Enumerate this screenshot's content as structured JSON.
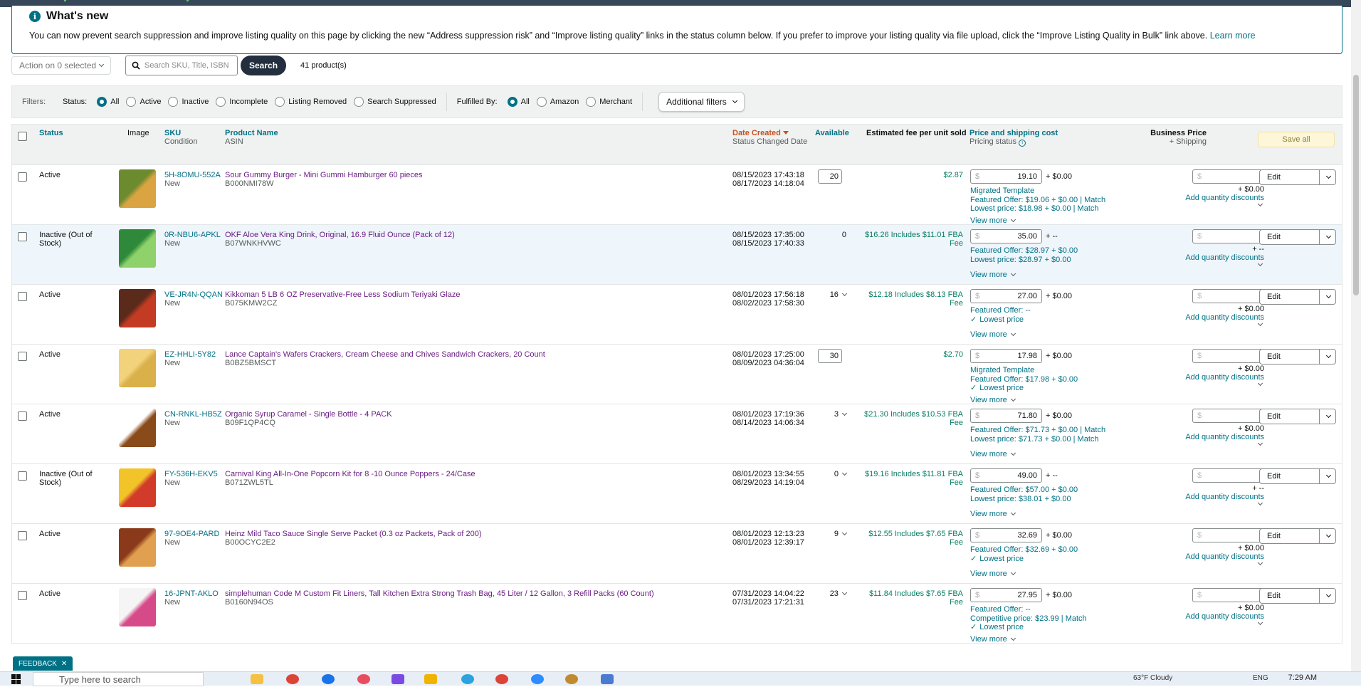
{
  "banner": {
    "title": "What's new",
    "message": "You can now prevent search suppression and improve listing quality on this page by clicking the new “Address suppression risk” and “Improve listing quality” links in the status column below. If you prefer to improve your listing quality via file upload, click the “Improve Listing Quality in Bulk” link above.",
    "learn_more": "Learn more"
  },
  "toolbar": {
    "action_label": "Action on 0 selected",
    "search_placeholder": "Search SKU, Title, ISBN",
    "search_button": "Search",
    "product_count": "41 product(s)"
  },
  "filters": {
    "label": "Filters:",
    "status_label": "Status:",
    "status_options": [
      "All",
      "Active",
      "Inactive",
      "Incomplete",
      "Listing Removed",
      "Search Suppressed"
    ],
    "fulfilled_label": "Fulfilled By:",
    "fulfilled_options": [
      "All",
      "Amazon",
      "Merchant"
    ],
    "additional_filters": "Additional filters"
  },
  "columns": {
    "status": "Status",
    "image": "Image",
    "sku": "SKU",
    "condition": "Condition",
    "product_name": "Product Name",
    "asin": "ASIN",
    "date_created": "Date Created",
    "status_changed": "Status Changed Date",
    "available": "Available",
    "est_fee": "Estimated fee per unit sold",
    "price_shipping": "Price and shipping cost",
    "pricing_status": "Pricing status",
    "business_price": "Business Price",
    "plus_shipping": "+ Shipping",
    "save_all": "Save all"
  },
  "common": {
    "dollar": "$",
    "add_qty": "Add quantity discounts",
    "view_more": "View more",
    "edit": "Edit",
    "bp_ship": "+ $0.00",
    "bp_ship_dash": "+ --"
  },
  "rows": [
    {
      "status": "Active",
      "sku": "5H-8OMU-552A",
      "condition": "New",
      "name": "Sour Gummy Burger - Mini Gummi Hamburger 60 pieces",
      "asin": "B000NMI78W",
      "created": "08/15/2023 17:43:18",
      "changed": "08/17/2023 14:18:04",
      "available": "20",
      "fee": "$2.87",
      "price": "19.10",
      "ship": "+ $0.00",
      "lines": [
        "Migrated Template",
        "Featured Offer: $19.06 + $0.00 | Match",
        "Lowest price: $18.98 + $0.00 | Match"
      ],
      "bp_ship": "+ $0.00"
    },
    {
      "status": "Inactive (Out of Stock)",
      "sku": "0R-NBU6-APKL",
      "condition": "New",
      "name": "OKF Aloe Vera King Drink, Original, 16.9 Fluid Ounce (Pack of 12)",
      "asin": "B07WNKHVWC",
      "created": "08/15/2023 17:35:00",
      "changed": "08/15/2023 17:40:33",
      "available": "0",
      "fee": "$16.26 Includes $11.01 FBA Fee",
      "price": "35.00",
      "ship": "+ --",
      "lines": [
        "Featured Offer: $28.97 + $0.00",
        "Lowest price: $28.97 + $0.00"
      ],
      "bp_ship": "+ --"
    },
    {
      "status": "Active",
      "sku": "VE-JR4N-QQAN",
      "condition": "New",
      "name": "Kikkoman 5 LB 6 OZ Preservative-Free Less Sodium Teriyaki Glaze",
      "asin": "B075KMW2CZ",
      "created": "08/01/2023 17:56:18",
      "changed": "08/02/2023 17:58:30",
      "available": "16",
      "fee": "$12.18 Includes $8.13 FBA Fee",
      "price": "27.00",
      "ship": "+ $0.00",
      "lines": [
        "Featured Offer: --",
        "✓ Lowest price"
      ],
      "bp_ship": "+ $0.00"
    },
    {
      "status": "Active",
      "sku": "EZ-HHLI-5Y82",
      "condition": "New",
      "name": "Lance Captain's Wafers Crackers, Cream Cheese and Chives Sandwich Crackers, 20 Count",
      "asin": "B0BZ5BMSCT",
      "created": "08/01/2023 17:25:00",
      "changed": "08/09/2023 04:36:04",
      "available": "30",
      "fee": "$2.70",
      "price": "17.98",
      "ship": "+ $0.00",
      "lines": [
        "Migrated Template",
        "Featured Offer: $17.98 + $0.00",
        "✓ Lowest price"
      ],
      "bp_ship": "+ $0.00"
    },
    {
      "status": "Active",
      "sku": "CN-RNKL-HB5Z",
      "condition": "New",
      "name": "Organic Syrup Caramel - Single Bottle - 4 PACK",
      "asin": "B09F1QP4CQ",
      "created": "08/01/2023 17:19:36",
      "changed": "08/14/2023 14:06:34",
      "available": "3",
      "fee": "$21.30 Includes $10.53 FBA Fee",
      "price": "71.80",
      "ship": "+ $0.00",
      "lines": [
        "Featured Offer: $71.73 + $0.00 | Match",
        "Lowest price: $71.73 + $0.00 | Match"
      ],
      "bp_ship": "+ $0.00"
    },
    {
      "status": "Inactive (Out of Stock)",
      "sku": "FY-536H-EKV5",
      "condition": "New",
      "name": "Carnival King All-In-One Popcorn Kit for 8 -10 Ounce Poppers - 24/Case",
      "asin": "B071ZWL5TL",
      "created": "08/01/2023 13:34:55",
      "changed": "08/29/2023 14:19:04",
      "available": "0",
      "fee": "$19.16 Includes $11.81 FBA Fee",
      "price": "49.00",
      "ship": "+ --",
      "lines": [
        "Featured Offer: $57.00 + $0.00",
        "Lowest price: $38.01 + $0.00"
      ],
      "bp_ship": "+ --"
    },
    {
      "status": "Active",
      "sku": "97-9OE4-PARD",
      "condition": "New",
      "name": "Heinz Mild Taco Sauce Single Serve Packet (0.3 oz Packets, Pack of 200)",
      "asin": "B00OCYC2E2",
      "created": "08/01/2023 12:13:23",
      "changed": "08/01/2023 12:39:17",
      "available": "9",
      "fee": "$12.55 Includes $7.65 FBA Fee",
      "price": "32.69",
      "ship": "+ $0.00",
      "lines": [
        "Featured Offer: $32.69 + $0.00",
        "✓ Lowest price"
      ],
      "bp_ship": "+ $0.00"
    },
    {
      "status": "Active",
      "sku": "16-JPNT-AKLO",
      "condition": "New",
      "name": "simplehuman Code M Custom Fit Liners, Tall Kitchen Extra Strong Trash Bag, 45 Liter / 12 Gallon, 3 Refill Packs (60 Count)",
      "asin": "B0160N94OS",
      "created": "07/31/2023 14:04:22",
      "changed": "07/31/2023 17:21:31",
      "available": "23",
      "fee": "$11.84 Includes $7.65 FBA Fee",
      "price": "27.95",
      "ship": "+ $0.00",
      "lines": [
        "Featured Offer: --",
        "Competitive price: $23.99 | Match",
        "✓ Lowest price"
      ],
      "bp_ship": "+ $0.00"
    }
  ],
  "feedback": "FEEDBACK",
  "taskbar": {
    "search_placeholder": "Type here to search",
    "weather": "63°F Cloudy",
    "lang": "ENG",
    "time": "7:29 AM"
  }
}
